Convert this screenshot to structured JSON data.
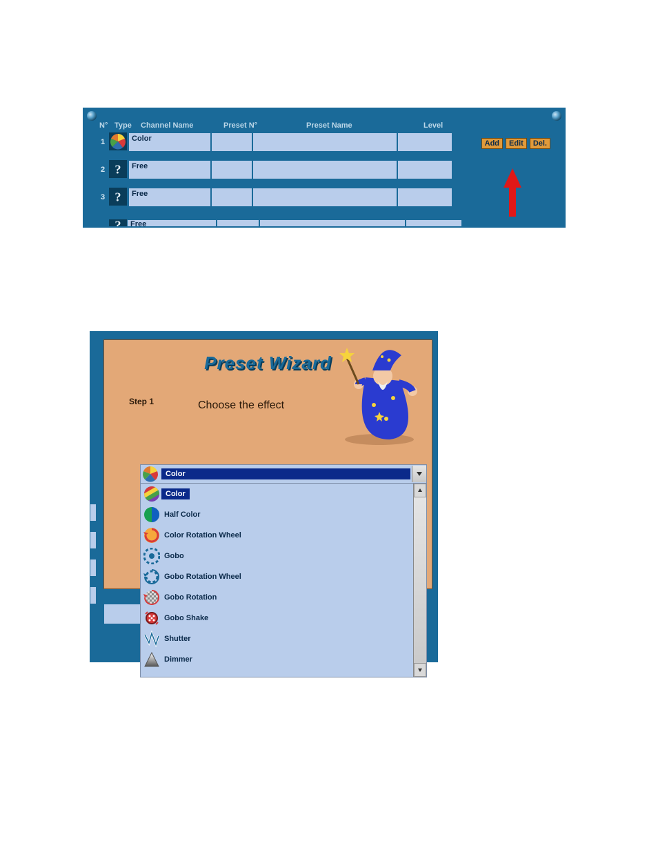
{
  "table": {
    "headers": {
      "no": "N°",
      "type": "Type",
      "channel_name": "Channel Name",
      "preset_no": "Preset N°",
      "preset_name": "Preset Name",
      "level": "Level"
    },
    "rows": [
      {
        "no": "1",
        "channel_name": "Color",
        "type_icon": "color-wheel"
      },
      {
        "no": "2",
        "channel_name": "Free",
        "type_icon": "question"
      },
      {
        "no": "3",
        "channel_name": "Free",
        "type_icon": "question"
      }
    ],
    "partial_row": {
      "channel_name": "Free",
      "type_icon": "question"
    },
    "buttons": {
      "add": "Add",
      "edit": "Edit",
      "del": "Del."
    }
  },
  "wizard": {
    "title": "Preset Wizard",
    "step_label": "Step 1",
    "instruction": "Choose the effect",
    "selected": "Color",
    "options": [
      {
        "label": "Color",
        "icon": "color-wheel-stripes"
      },
      {
        "label": "Half Color",
        "icon": "half-color"
      },
      {
        "label": "Color Rotation Wheel",
        "icon": "color-rotation"
      },
      {
        "label": "Gobo",
        "icon": "gobo"
      },
      {
        "label": "Gobo Rotation Wheel",
        "icon": "gobo-rotation-wheel"
      },
      {
        "label": "Gobo Rotation",
        "icon": "gobo-rotation"
      },
      {
        "label": "Gobo Shake",
        "icon": "gobo-shake"
      },
      {
        "label": "Shutter",
        "icon": "shutter"
      },
      {
        "label": "Dimmer",
        "icon": "dimmer"
      }
    ]
  }
}
